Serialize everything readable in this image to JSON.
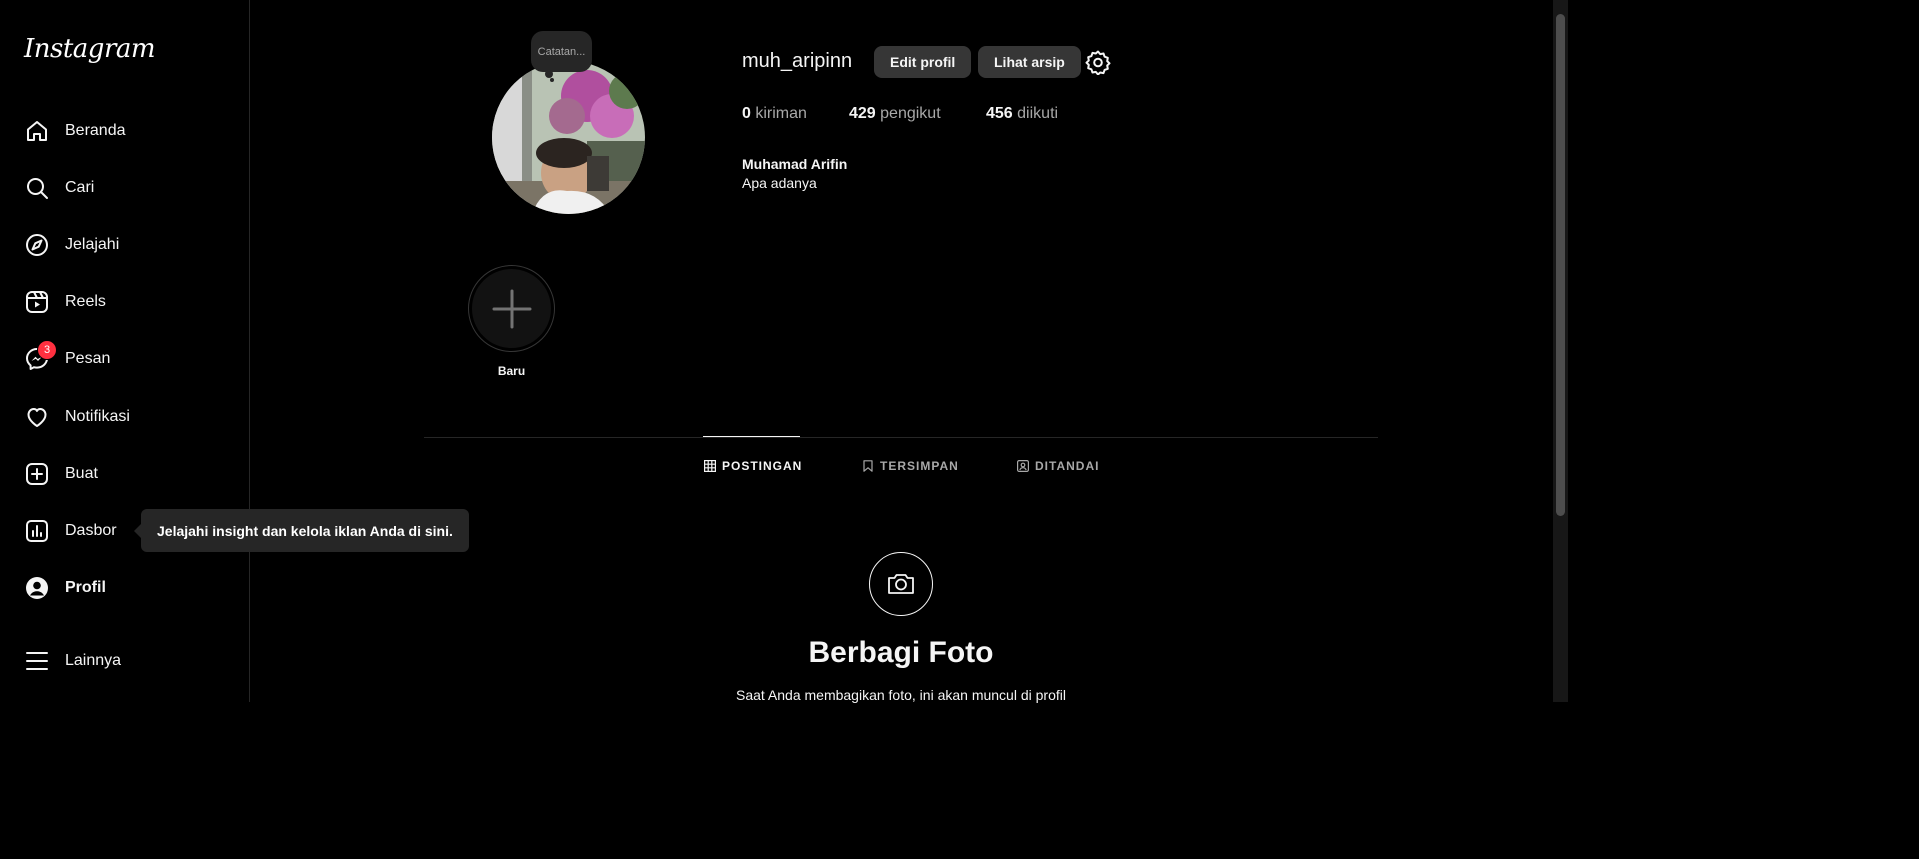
{
  "sidebar": {
    "logo": "Instagram",
    "items": [
      {
        "label": "Beranda",
        "icon": "home-icon"
      },
      {
        "label": "Cari",
        "icon": "search-icon"
      },
      {
        "label": "Jelajahi",
        "icon": "compass-icon"
      },
      {
        "label": "Reels",
        "icon": "reels-icon"
      },
      {
        "label": "Pesan",
        "icon": "messenger-icon",
        "badge": "3"
      },
      {
        "label": "Notifikasi",
        "icon": "heart-icon"
      },
      {
        "label": "Buat",
        "icon": "plus-square-icon"
      },
      {
        "label": "Dasbor",
        "icon": "dashboard-icon"
      },
      {
        "label": "Profil",
        "icon": "profile-icon",
        "active": true
      },
      {
        "label": "Lainnya",
        "icon": "menu-icon"
      }
    ],
    "tooltip": "Jelajahi insight dan kelola iklan Anda di sini."
  },
  "profile": {
    "note": "Catatan...",
    "username": "muh_aripinn",
    "edit_button": "Edit profil",
    "archive_button": "Lihat arsip",
    "stats": {
      "posts_count": "0",
      "posts_label": "kiriman",
      "followers_count": "429",
      "followers_label": "pengikut",
      "following_count": "456",
      "following_label": "diikuti"
    },
    "full_name": "Muhamad Arifin",
    "bio": "Apa adanya"
  },
  "highlights": {
    "new_label": "Baru"
  },
  "tabs": [
    {
      "label": "POSTINGAN",
      "icon": "grid-icon",
      "active": true
    },
    {
      "label": "TERSIMPAN",
      "icon": "bookmark-icon"
    },
    {
      "label": "DITANDAI",
      "icon": "tagged-icon"
    }
  ],
  "empty_state": {
    "title": "Berbagi Foto",
    "subtitle": "Saat Anda membagikan foto, ini akan muncul di profil"
  },
  "colors": {
    "background": "#000000",
    "surface": "#262626",
    "button": "#363636",
    "badge": "#ff3040",
    "text": "#f5f5f5",
    "muted": "#a8a8a8"
  }
}
